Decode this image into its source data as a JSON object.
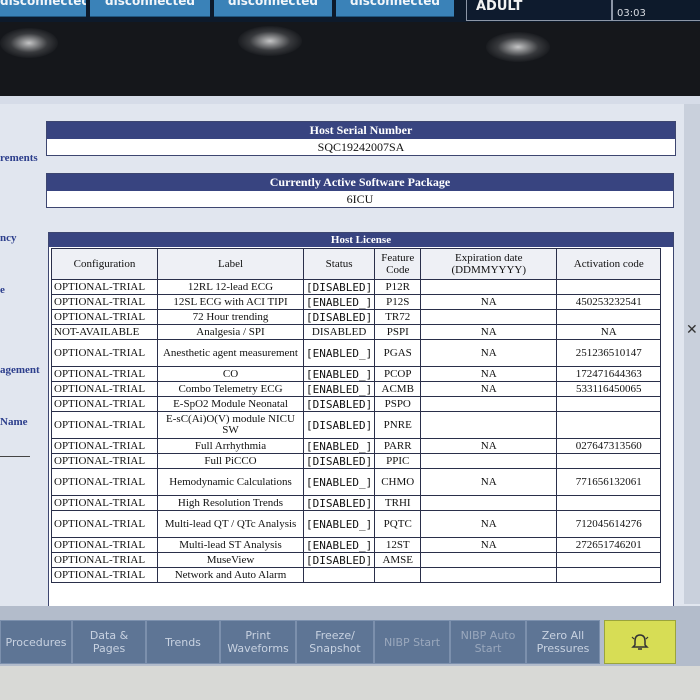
{
  "top_tabs": [
    "disconnected",
    "disconnected",
    "disconnected",
    "disconnected"
  ],
  "patient_type": "ADULT",
  "clock": "03:03",
  "side_labels": [
    "rements",
    "ncy",
    "e",
    "agement",
    "Name"
  ],
  "host_serial": {
    "title": "Host Serial Number",
    "value": "SQC19242007SA"
  },
  "software_package": {
    "title": "Currently Active Software Package",
    "value": "6ICU"
  },
  "license": {
    "title": "Host License",
    "headers": [
      "Configuration",
      "Label",
      "Status",
      "Feature Code",
      "Expiration date (DDMMYYYY)",
      "Activation code"
    ],
    "rows": [
      {
        "config": "OPTIONAL-TRIAL",
        "label": "12RL 12-lead ECG",
        "status": "[DISABLED]",
        "code": "P12R",
        "expiration": "",
        "activation": ""
      },
      {
        "config": "OPTIONAL-TRIAL",
        "label": "12SL ECG with ACI TIPI",
        "status": "[ENABLED_]",
        "code": "P12S",
        "expiration": "NA",
        "activation": "450253232541"
      },
      {
        "config": "OPTIONAL-TRIAL",
        "label": "72 Hour trending",
        "status": "[DISABLED]",
        "code": "TR72",
        "expiration": "",
        "activation": ""
      },
      {
        "config": "NOT-AVAILABLE",
        "label": "Analgesia / SPI",
        "status": "DISABLED",
        "code": "PSPI",
        "expiration": "NA",
        "activation": "NA"
      },
      {
        "config": "OPTIONAL-TRIAL",
        "label": "Anesthetic agent measurement",
        "status": "[ENABLED_]",
        "code": "PGAS",
        "expiration": "NA",
        "activation": "251236510147"
      },
      {
        "config": "OPTIONAL-TRIAL",
        "label": "CO",
        "status": "[ENABLED_]",
        "code": "PCOP",
        "expiration": "NA",
        "activation": "172471644363"
      },
      {
        "config": "OPTIONAL-TRIAL",
        "label": "Combo Telemetry ECG",
        "status": "[ENABLED_]",
        "code": "ACMB",
        "expiration": "NA",
        "activation": "533116450065"
      },
      {
        "config": "OPTIONAL-TRIAL",
        "label": "E-SpO2 Module Neonatal",
        "status": "[DISABLED]",
        "code": "PSPO",
        "expiration": "",
        "activation": ""
      },
      {
        "config": "OPTIONAL-TRIAL",
        "label": "E-sC(Ai)O(V) module NICU SW",
        "status": "[DISABLED]",
        "code": "PNRE",
        "expiration": "",
        "activation": ""
      },
      {
        "config": "OPTIONAL-TRIAL",
        "label": "Full Arrhythmia",
        "status": "[ENABLED_]",
        "code": "PARR",
        "expiration": "NA",
        "activation": "027647313560"
      },
      {
        "config": "OPTIONAL-TRIAL",
        "label": "Full PiCCO",
        "status": "[DISABLED]",
        "code": "PPIC",
        "expiration": "",
        "activation": ""
      },
      {
        "config": "OPTIONAL-TRIAL",
        "label": "Hemodynamic Calculations",
        "status": "[ENABLED_]",
        "code": "CHMO",
        "expiration": "NA",
        "activation": "771656132061"
      },
      {
        "config": "OPTIONAL-TRIAL",
        "label": "High Resolution Trends",
        "status": "[DISABLED]",
        "code": "TRHI",
        "expiration": "",
        "activation": ""
      },
      {
        "config": "OPTIONAL-TRIAL",
        "label": "Multi-lead QT / QTc Analysis",
        "status": "[ENABLED_]",
        "code": "PQTC",
        "expiration": "NA",
        "activation": "712045614276"
      },
      {
        "config": "OPTIONAL-TRIAL",
        "label": "Multi-lead ST Analysis",
        "status": "[ENABLED_]",
        "code": "12ST",
        "expiration": "NA",
        "activation": "272651746201"
      },
      {
        "config": "OPTIONAL-TRIAL",
        "label": "MuseView",
        "status": "[DISABLED]",
        "code": "AMSE",
        "expiration": "",
        "activation": ""
      },
      {
        "config": "OPTIONAL-TRIAL",
        "label": "Network and Auto Alarm",
        "status": "",
        "code": "",
        "expiration": "",
        "activation": ""
      }
    ]
  },
  "bottom_buttons": [
    {
      "label": "Procedures",
      "dim": false
    },
    {
      "label": "Data & Pages",
      "dim": false
    },
    {
      "label": "Trends",
      "dim": false
    },
    {
      "label": "Print Waveforms",
      "dim": false
    },
    {
      "label": "Freeze/ Snapshot",
      "dim": false
    },
    {
      "label": "NIBP Start",
      "dim": true
    },
    {
      "label": "NIBP Auto Start",
      "dim": true
    },
    {
      "label": "Zero All Pressures",
      "dim": false
    }
  ],
  "alarm_icon": "bell-icon",
  "colors": {
    "header_blue": "#384480",
    "tab_blue": "#3a82b8",
    "alarm_yellow": "#d7dd55",
    "button_blue": "#5e7595"
  }
}
